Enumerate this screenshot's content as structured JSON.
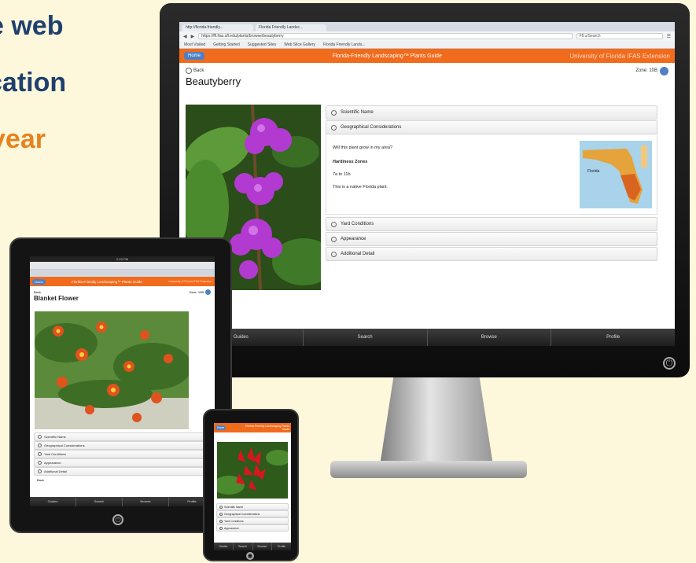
{
  "headline": {
    "line1": "e web",
    "line2": "cation",
    "line3": "year"
  },
  "colors": {
    "accent_orange": "#f16b1d",
    "home_blue": "#4f7fc5",
    "headline_blue": "#1f3f6e",
    "headline_orange": "#e8821e",
    "background": "#fdf8dc"
  },
  "desktop": {
    "browser": {
      "tabs": [
        "http://florida-friendly...",
        "Florida Friendly Landsc..."
      ],
      "url": "https://ffl.ifas.ufl.edu/plants/browse/beautyberry",
      "search_placeholder": "Ffl.u/Search",
      "bookmarks": [
        "Most Visited",
        "Getting Started",
        "Suggested Sites",
        "Web Slice Gallery",
        "Florida Friendly Lands..."
      ]
    },
    "appbar": {
      "home": "Home",
      "title": "Florida-Friendly Landscaping™ Plants Guide",
      "extension": "University of Florida IFAS Extension"
    },
    "back": "Back",
    "zone_label": "Zone: 10B",
    "plant_name": "Beautyberry",
    "sections": [
      "Scientific Name",
      "Geographical Considerations",
      "Yard Conditions",
      "Appearance",
      "Additional Detail"
    ],
    "geo": {
      "question": "Will this plant grow in my area?",
      "zones_heading": "Hardiness Zones",
      "zones": "7a to 11b",
      "native": "This is a native Florida plant.",
      "map_label": "Florida"
    },
    "footer": [
      "Guides",
      "Search",
      "Browse",
      "Profile"
    ]
  },
  "tablet": {
    "status_time": "2:43 PM",
    "appbar": {
      "home": "Home",
      "title": "Florida-Friendly Landscaping™ Plants Guide",
      "extension": "University of Florida IFAS Extension"
    },
    "back": "Back",
    "zone_label": "Zone: 10B",
    "plant_name": "Blanket Flower",
    "sections": [
      "Scientific Name",
      "Geographical Considerations",
      "Yard Conditions",
      "Appearance",
      "Additional Detail"
    ],
    "back_bottom": "Back",
    "footer": [
      "Guides",
      "Search",
      "Browse",
      "Profile"
    ]
  },
  "phone": {
    "appbar": {
      "home": "Home",
      "title": "Florida-Friendly Landscaping Plants Guide"
    },
    "sections": [
      "Scientific Name",
      "Geographical Considerations",
      "Yard Conditions",
      "Appearance"
    ],
    "footer": [
      "Guides",
      "Search",
      "Browse",
      "Profile"
    ]
  }
}
